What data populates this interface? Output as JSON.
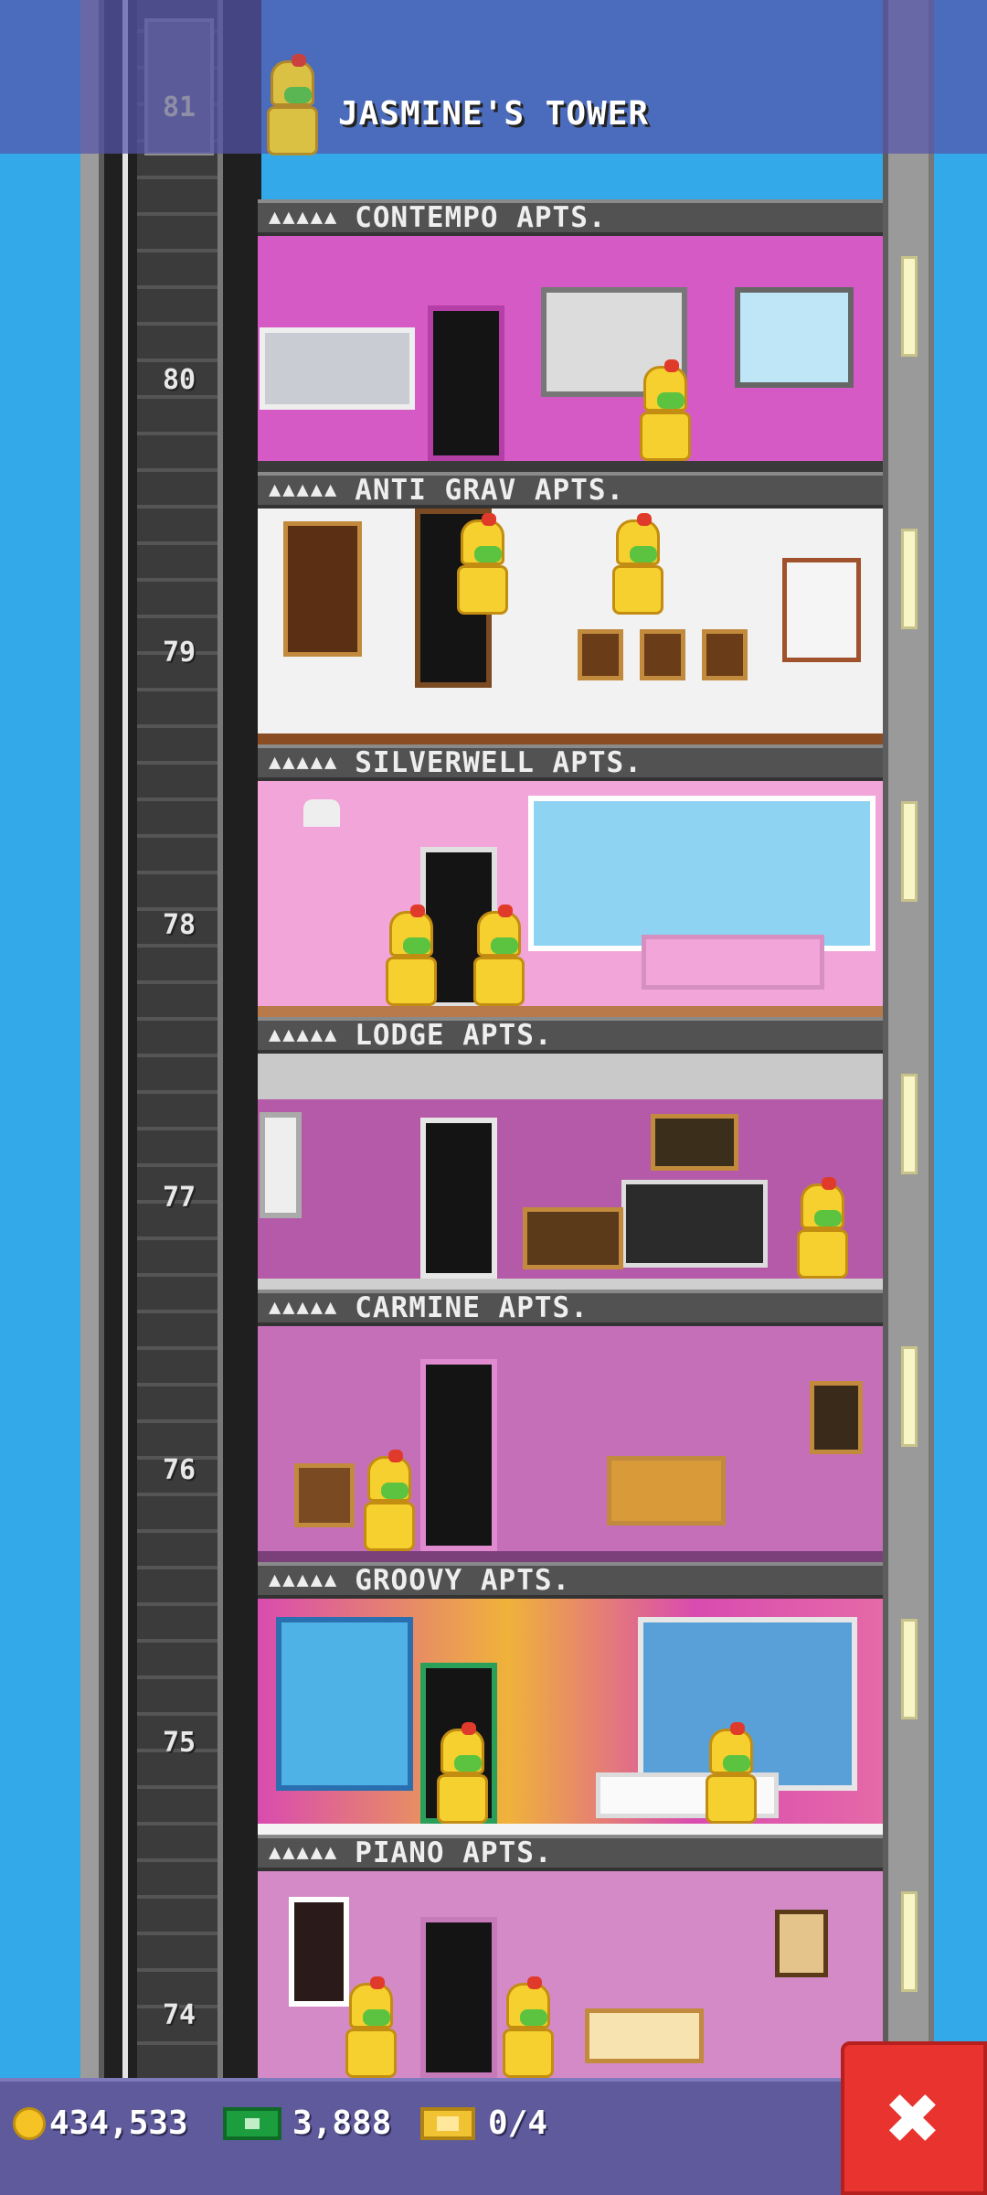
{
  "tower": {
    "title": "JASMINE'S TOWER",
    "top_floor_number": "81"
  },
  "floors": [
    {
      "number": "80",
      "sign": "CONTEMPO APTS.",
      "stars": "▲▲▲▲▲"
    },
    {
      "number": "79",
      "sign": "ANTI GRAV APTS.",
      "stars": "▲▲▲▲▲"
    },
    {
      "number": "78",
      "sign": "SILVERWELL APTS.",
      "stars": "▲▲▲▲▲"
    },
    {
      "number": "77",
      "sign": "LODGE APTS.",
      "stars": "▲▲▲▲▲"
    },
    {
      "number": "76",
      "sign": "CARMINE APTS.",
      "stars": "▲▲▲▲▲"
    },
    {
      "number": "75",
      "sign": "GROOVY APTS.",
      "stars": "▲▲▲▲▲"
    },
    {
      "number": "74",
      "sign": "PIANO APTS.",
      "stars": "▲▲▲▲▲"
    }
  ],
  "status_bar": {
    "coins": "434,533",
    "bux": "3,888",
    "tickets": "0/4"
  },
  "icons": {
    "coin": "coin-icon",
    "bux": "bux-icon",
    "ticket": "ticket-icon",
    "close": "close-icon"
  },
  "close_label": "✖",
  "colors": {
    "sky": "#33a9ea",
    "status_bar": "#5e5a9b",
    "close_button": "#e8332f"
  }
}
